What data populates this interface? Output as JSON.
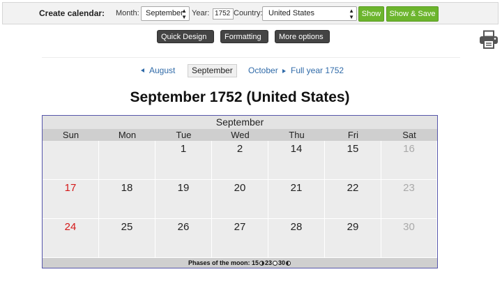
{
  "toolbar": {
    "create_label": "Create calendar:",
    "month_label": "Month:",
    "month_value": "September",
    "year_label": "Year:",
    "year_value": "1752",
    "country_label": "Country:",
    "country_value": "United States",
    "show_label": "Show",
    "show_save_label": "Show & Save"
  },
  "menus": {
    "quick_design": "Quick Design",
    "formatting": "Formatting",
    "more_options": "More options"
  },
  "nav": {
    "prev": "August",
    "current": "September",
    "next": "October",
    "full_year": "Full year 1752"
  },
  "page_title": "September 1752 (United States)",
  "calendar": {
    "month_name": "September",
    "weekdays": [
      "Sun",
      "Mon",
      "Tue",
      "Wed",
      "Thu",
      "Fri",
      "Sat"
    ],
    "weeks": [
      [
        "",
        "",
        "1",
        "2",
        "14",
        "15",
        "16"
      ],
      [
        "17",
        "18",
        "19",
        "20",
        "21",
        "22",
        "23"
      ],
      [
        "24",
        "25",
        "26",
        "27",
        "28",
        "29",
        "30"
      ]
    ],
    "colors": {
      "sunday": "#d41818",
      "saturday": "#a9a9a9",
      "border": "#5555aa"
    },
    "moon_label": "Phases of the moon:",
    "moon_phases": [
      {
        "day": "15",
        "phase": "first-quarter"
      },
      {
        "day": "23",
        "phase": "full"
      },
      {
        "day": "30",
        "phase": "last-quarter"
      }
    ]
  },
  "icons": {
    "print": "printer-icon"
  }
}
